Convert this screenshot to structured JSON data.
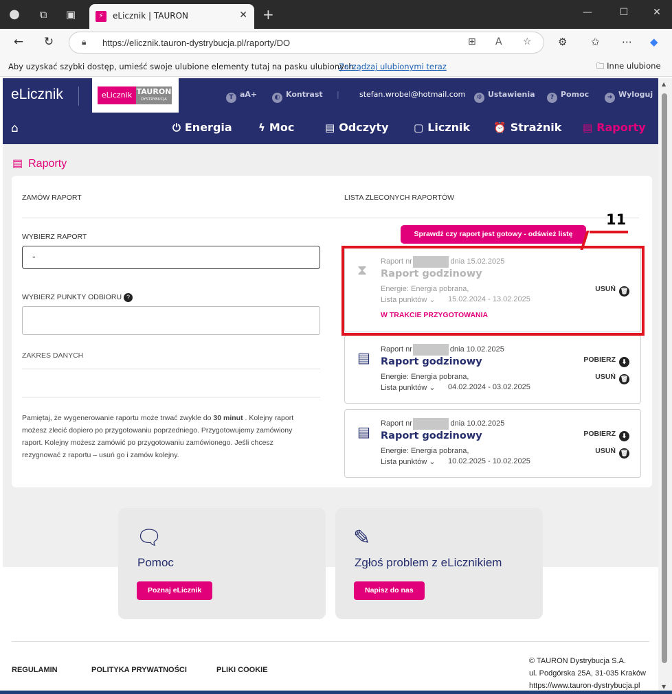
{
  "browser": {
    "tab_title": "eLicznik | TAURON",
    "url": "https://elicznik.tauron-dystrybucja.pl/raporty/DO",
    "favbar_text": "Aby uzyskać szybki dostęp, umieść swoje ulubione elementy tutaj na pasku ulubionych.",
    "favbar_link": "Zarządzaj ulubionymi teraz",
    "favbar_other": "Inne ulubione"
  },
  "site": {
    "brand": "eLicznik",
    "logo_left": "eLicznik",
    "logo_right": "TAURON",
    "logo_sub": "DYSTRYBUCJA",
    "top": {
      "font": "aA+",
      "contrast": "Kontrast",
      "email": "stefan.wrobel@hotmail.com",
      "settings": "Ustawienia",
      "help": "Pomoc",
      "logout": "Wyloguj"
    },
    "menu": {
      "energia": "Energia",
      "moc": "Moc",
      "odczyty": "Odczyty",
      "licznik": "Licznik",
      "straznik": "Strażnik",
      "raporty": "Raporty"
    }
  },
  "page": {
    "title": "Raporty",
    "order_heading": "ZAMÓW RAPORT",
    "list_heading": "LISTA ZLECONYCH RAPORTÓW",
    "choose_report_label": "WYBIERZ RAPORT",
    "choose_report_value": "-",
    "choose_points_label": "WYBIERZ PUNKTY ODBIORU",
    "range_label": "ZAKRES DANYCH",
    "note_pre": "Pamiętaj, że wygenerowanie raportu może trwać zwykle do",
    "note_bold": "30 minut",
    "note_post": ". Kolejny raport możesz zlecić dopiero po przygotowaniu poprzedniego. Przygotowujemy zamówiony raport. Kolejny możesz zamówić po przygotowaniu zamówionego. Jeśli chcesz rezygnować z raportu – usuń go i zamów kolejny.",
    "refresh_button": "Sprawdź czy raport jest gotowy - odśwież listę",
    "annotation": "11"
  },
  "reports": [
    {
      "num_prefix": "Raport nr",
      "num_suffix": "z dnia 15.02.2025",
      "title": "Raport godzinowy",
      "energy": "Energie: Energia pobrana,",
      "points": "Lista punktów",
      "range": "15.02.2024 - 13.02.2025",
      "status": "W TRAKCIE PRZYGOTOWANIA",
      "delete": "USUŃ"
    },
    {
      "num_prefix": "Raport nr",
      "num_suffix": "dnia 10.02.2025",
      "title": "Raport godzinowy",
      "energy": "Energie: Energia pobrana,",
      "points": "Lista punktów",
      "range": "04.02.2024 - 03.02.2025",
      "download": "POBIERZ",
      "delete": "USUŃ"
    },
    {
      "num_prefix": "Raport nr",
      "num_suffix": "z dnia 10.02.2025",
      "title": "Raport godzinowy",
      "energy": "Energie: Energia pobrana,",
      "points": "Lista punktów",
      "range": "10.02.2025 - 10.02.2025",
      "download": "POBIERZ",
      "delete": "USUŃ"
    }
  ],
  "tiles": {
    "help_title": "Pomoc",
    "help_button": "Poznaj eLicznik",
    "problem_title": "Zgłoś problem z eLicznikiem",
    "problem_button": "Napisz do nas"
  },
  "footer": {
    "regulamin": "REGULAMIN",
    "privacy": "POLITYKA PRYWATNOŚCI",
    "cookies": "PLIKI COOKIE",
    "company": "© TAURON Dystrybucja S.A.",
    "address": "ul. Podgórska 25A, 31-035 Kraków",
    "web": "https://www.tauron-dystrybucja.pl"
  }
}
